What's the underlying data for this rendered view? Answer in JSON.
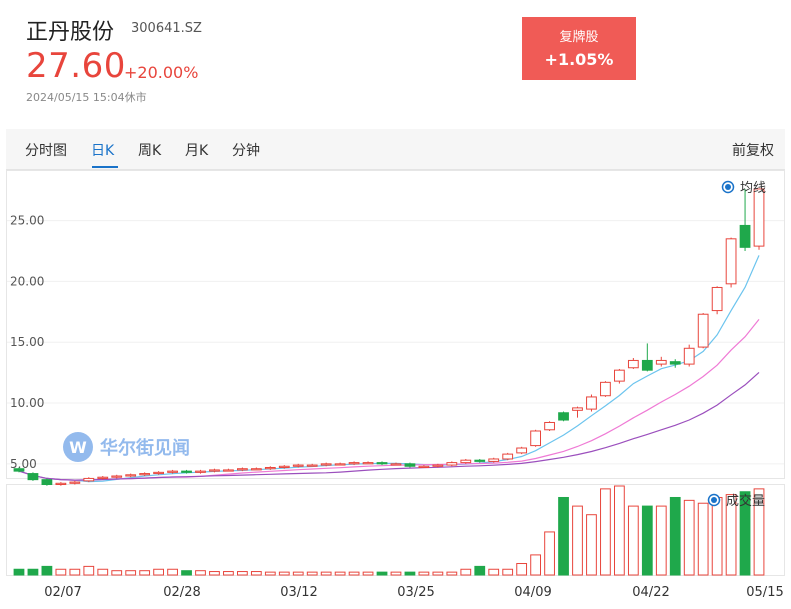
{
  "header": {
    "name": "正丹股份",
    "code": "300641.SZ",
    "price": "27.60",
    "change_pct": "+20.00%",
    "timestamp": "2024/05/15 15:04休市",
    "resume_label": "复牌股",
    "resume_value": "+1.05%"
  },
  "tabs": {
    "fenshi": "分时图",
    "daily": "日K",
    "weekly": "周K",
    "monthly": "月K",
    "minute": "分钟",
    "adjust": "前复权"
  },
  "legend": {
    "ma": "均线",
    "volume": "成交量"
  },
  "watermark": "华尔街见闻",
  "colors": {
    "up": "#e8453c",
    "down": "#1fa84b",
    "accent": "#1a73c9",
    "ma5": "#6cc4ee",
    "ma10": "#ef7ad5",
    "ma20": "#9b4fbd"
  },
  "chart_data": {
    "type": "candlestick",
    "y_ticks": [
      "25.00",
      "20.00",
      "15.00",
      "10.00",
      "5.00"
    ],
    "ylim": [
      4.0,
      28.5
    ],
    "x_ticks": [
      "02/07",
      "02/28",
      "03/12",
      "03/25",
      "04/09",
      "04/22",
      "05/15"
    ],
    "series": [
      {
        "name": "K线",
        "values": [
          [
            4.6,
            4.4,
            4.7,
            4.3
          ],
          [
            4.2,
            3.7,
            4.3,
            3.6
          ],
          [
            3.7,
            3.3,
            3.8,
            3.2
          ],
          [
            3.3,
            3.4,
            3.5,
            3.2
          ],
          [
            3.4,
            3.5,
            3.6,
            3.3
          ],
          [
            3.6,
            3.8,
            3.9,
            3.5
          ],
          [
            3.8,
            3.9,
            4.0,
            3.7
          ],
          [
            3.9,
            4.0,
            4.1,
            3.8
          ],
          [
            4.0,
            4.1,
            4.2,
            3.9
          ],
          [
            4.1,
            4.2,
            4.3,
            4.0
          ],
          [
            4.2,
            4.3,
            4.4,
            4.1
          ],
          [
            4.3,
            4.4,
            4.5,
            4.2
          ],
          [
            4.4,
            4.3,
            4.5,
            4.2
          ],
          [
            4.3,
            4.4,
            4.5,
            4.2
          ],
          [
            4.4,
            4.5,
            4.6,
            4.3
          ],
          [
            4.5,
            4.5,
            4.6,
            4.4
          ],
          [
            4.5,
            4.6,
            4.7,
            4.4
          ],
          [
            4.6,
            4.6,
            4.7,
            4.5
          ],
          [
            4.6,
            4.7,
            4.8,
            4.5
          ],
          [
            4.7,
            4.8,
            4.9,
            4.6
          ],
          [
            4.8,
            4.9,
            5.0,
            4.7
          ],
          [
            4.9,
            4.9,
            5.0,
            4.8
          ],
          [
            4.9,
            5.0,
            5.1,
            4.8
          ],
          [
            5.0,
            5.0,
            5.1,
            4.9
          ],
          [
            5.0,
            5.1,
            5.2,
            4.9
          ],
          [
            5.1,
            5.1,
            5.2,
            5.0
          ],
          [
            5.1,
            5.0,
            5.2,
            4.9
          ],
          [
            5.0,
            5.0,
            5.1,
            4.9
          ],
          [
            5.0,
            4.8,
            5.1,
            4.7
          ],
          [
            4.8,
            4.8,
            4.9,
            4.7
          ],
          [
            4.8,
            4.9,
            5.0,
            4.7
          ],
          [
            4.9,
            5.1,
            5.2,
            4.8
          ],
          [
            5.1,
            5.3,
            5.4,
            5.0
          ],
          [
            5.3,
            5.2,
            5.4,
            5.1
          ],
          [
            5.2,
            5.4,
            5.5,
            5.1
          ],
          [
            5.4,
            5.8,
            5.9,
            5.3
          ],
          [
            5.9,
            6.3,
            6.4,
            5.8
          ],
          [
            6.5,
            7.7,
            7.8,
            6.4
          ],
          [
            7.8,
            8.4,
            8.5,
            7.7
          ],
          [
            9.2,
            8.6,
            9.3,
            8.5
          ],
          [
            9.4,
            9.6,
            9.7,
            8.8
          ],
          [
            9.5,
            10.5,
            10.7,
            9.3
          ],
          [
            10.6,
            11.7,
            11.8,
            10.5
          ],
          [
            11.8,
            12.7,
            12.8,
            11.6
          ],
          [
            12.9,
            13.5,
            13.7,
            12.8
          ],
          [
            13.5,
            12.7,
            14.9,
            12.6
          ],
          [
            13.2,
            13.5,
            13.8,
            13.0
          ],
          [
            13.4,
            13.2,
            13.6,
            12.9
          ],
          [
            13.2,
            14.5,
            14.8,
            13.0
          ],
          [
            14.6,
            17.3,
            17.4,
            14.5
          ],
          [
            17.6,
            19.5,
            19.6,
            17.3
          ],
          [
            19.8,
            23.5,
            23.6,
            19.5
          ],
          [
            24.6,
            22.8,
            27.6,
            22.5
          ],
          [
            22.9,
            27.6,
            27.6,
            22.6
          ]
        ]
      },
      {
        "name": "成交量",
        "values": [
          2,
          2,
          3,
          2,
          2,
          3,
          2,
          1.5,
          1.5,
          1.5,
          2,
          2,
          1.5,
          1.5,
          1.2,
          1.2,
          1.2,
          1.2,
          1,
          1,
          1,
          1,
          1,
          1,
          1,
          1,
          1,
          1,
          1,
          1,
          1,
          1,
          2,
          3,
          2,
          2,
          4,
          7,
          15,
          27,
          24,
          21,
          30,
          31,
          24,
          24,
          24,
          27,
          26,
          25,
          27,
          28,
          29,
          30,
          29
        ]
      },
      {
        "name": "MA5",
        "values": []
      },
      {
        "name": "MA10",
        "values": []
      },
      {
        "name": "MA20",
        "values": []
      }
    ]
  }
}
